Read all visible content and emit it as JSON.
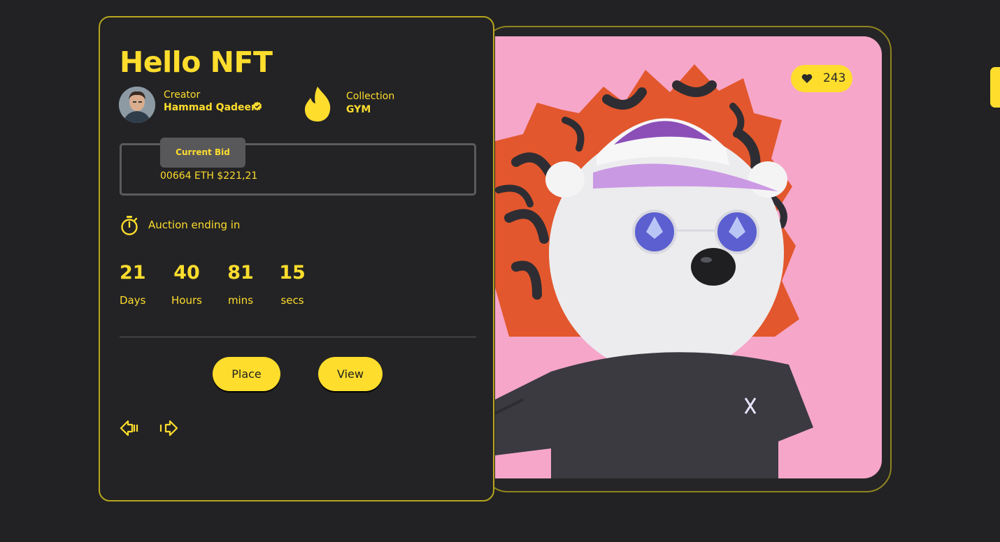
{
  "nft": {
    "title": "Hello NFT"
  },
  "creator": {
    "label": "Creator",
    "name": "Hammad Qadeer"
  },
  "collection": {
    "label": "Collection",
    "name": "GYM"
  },
  "bid": {
    "label": "Current Bid",
    "value": "00664 ETH $221,21"
  },
  "auction": {
    "label": "Auction ending in"
  },
  "countdown": [
    {
      "value": "21",
      "unit": "Days"
    },
    {
      "value": "40",
      "unit": "Hours"
    },
    {
      "value": "81",
      "unit": "mins"
    },
    {
      "value": "15",
      "unit": "secs"
    }
  ],
  "actions": {
    "place_label": "Place",
    "view_label": "View"
  },
  "likes": {
    "count": "243"
  },
  "icons": {
    "verified": "verified-badge-icon",
    "collection": "flame-icon",
    "timer": "stopwatch-icon",
    "prev": "arrow-left-icon",
    "next": "arrow-right-icon",
    "like": "heart-icon"
  },
  "colors": {
    "accent": "#fedd2d",
    "background": "#222224",
    "panel_border": "#b6a51d",
    "art_background": "#f6a6c9"
  }
}
